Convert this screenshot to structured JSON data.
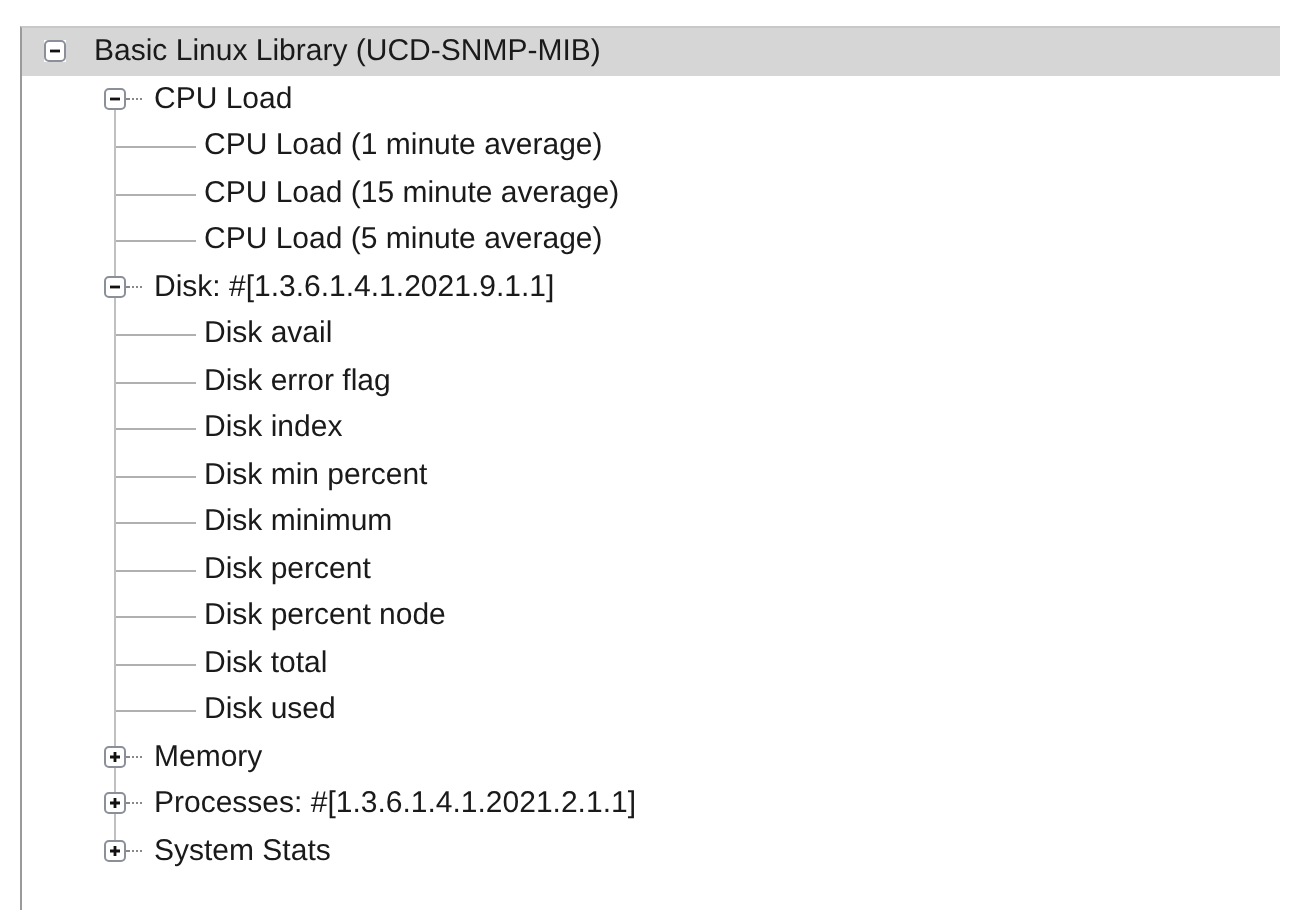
{
  "tree": {
    "label": "Basic Linux Library (UCD-SNMP-MIB)",
    "expanded": true,
    "selected": true,
    "children": [
      {
        "label": "CPU Load",
        "expanded": true,
        "selected": false,
        "children": [
          {
            "label": "CPU Load (1 minute average)",
            "selected": false
          },
          {
            "label": "CPU Load (15 minute average)",
            "selected": false
          },
          {
            "label": "CPU Load (5 minute average)",
            "selected": false
          }
        ]
      },
      {
        "label": "Disk: #[1.3.6.1.4.1.2021.9.1.1]",
        "expanded": true,
        "selected": false,
        "children": [
          {
            "label": "Disk avail",
            "selected": false
          },
          {
            "label": "Disk error flag",
            "selected": false
          },
          {
            "label": "Disk index",
            "selected": false
          },
          {
            "label": "Disk min percent",
            "selected": false
          },
          {
            "label": "Disk minimum",
            "selected": false
          },
          {
            "label": "Disk percent",
            "selected": false
          },
          {
            "label": "Disk percent node",
            "selected": false
          },
          {
            "label": "Disk total",
            "selected": false
          },
          {
            "label": "Disk used",
            "selected": false
          }
        ]
      },
      {
        "label": "Memory",
        "expanded": false,
        "selected": false
      },
      {
        "label": "Processes: #[1.3.6.1.4.1.2021.2.1.1]",
        "expanded": false,
        "selected": false
      },
      {
        "label": "System Stats",
        "expanded": false,
        "selected": false
      }
    ]
  }
}
